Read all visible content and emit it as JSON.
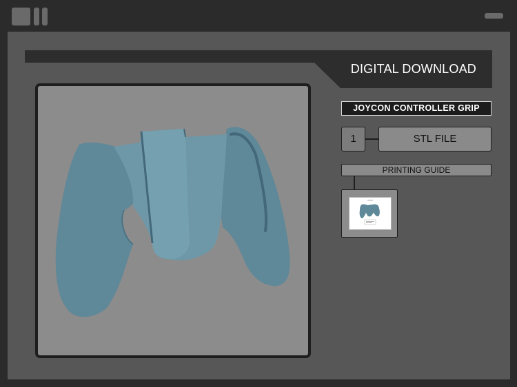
{
  "window": {
    "controls": [
      "app-menu-icon",
      "minimize-icon"
    ]
  },
  "header": {
    "title": "DIGITAL DOWNLOAD"
  },
  "product": {
    "title": "JOYCON CONTROLLER GRIP",
    "quantity": "1",
    "file_label": "STL FILE",
    "guide_label": "PRINTING GUIDE"
  },
  "colors": {
    "outer_frame": "#2b2b2b",
    "content_bg": "#575757",
    "header_bar": "#2d2d2d",
    "viewer_bg": "#8c8c8c",
    "model": "#5f8898"
  }
}
